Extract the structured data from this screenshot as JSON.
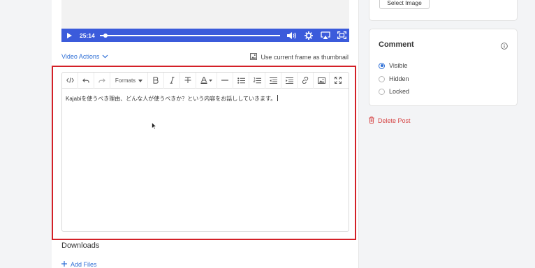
{
  "video": {
    "time": "25:14",
    "progress": 0.02,
    "accent_color": "#3b5bdb"
  },
  "actions": {
    "video_actions_label": "Video Actions",
    "thumbnail_label": "Use current frame as thumbnail"
  },
  "editor": {
    "toolbar": {
      "formats_label": "Formats",
      "buttons": [
        "code-view",
        "undo",
        "redo",
        "formats",
        "bold",
        "italic",
        "strikethrough",
        "text-color",
        "horizontal-rule",
        "bulleted-list",
        "numbered-list",
        "outdent",
        "indent",
        "link",
        "image",
        "fullscreen"
      ]
    },
    "content": "Kajabiを使うべき理由、どんな人が使うべきか？という内容をお話ししていきます。"
  },
  "downloads": {
    "title": "Downloads",
    "add_files_label": "Add Files"
  },
  "sidebar": {
    "select_image_label": "Select Image",
    "comment": {
      "title": "Comment",
      "options": [
        {
          "label": "Visible",
          "checked": true
        },
        {
          "label": "Hidden",
          "checked": false
        },
        {
          "label": "Locked",
          "checked": false
        }
      ]
    },
    "delete_label": "Delete Post"
  },
  "colors": {
    "link": "#2f6fd6",
    "danger": "#d64545",
    "highlight": "#d32027"
  }
}
